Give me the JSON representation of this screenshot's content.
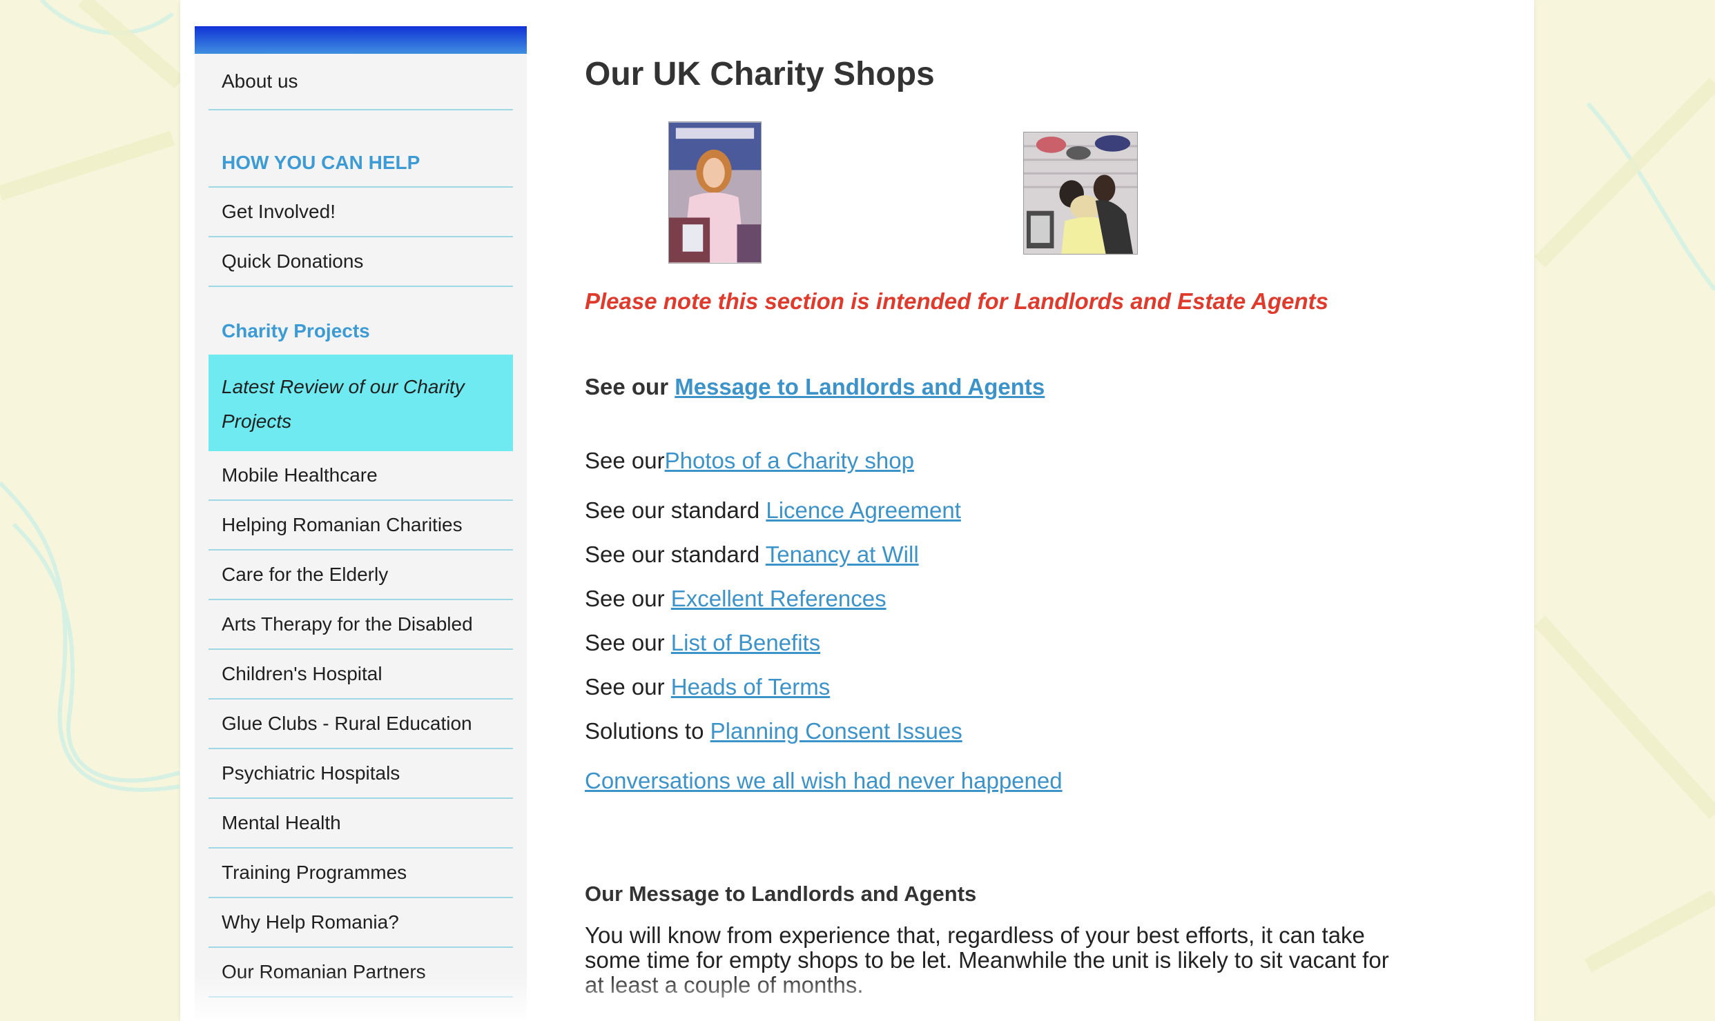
{
  "sidebar": {
    "about": "About us",
    "help_heading": "HOW YOU CAN HELP",
    "help_items": [
      "Get Involved!",
      "Quick Donations"
    ],
    "projects_heading": "Charity Projects",
    "active_item": "Latest Review of our Charity Projects",
    "project_items": [
      "Mobile Healthcare",
      "Helping Romanian Charities",
      "Care for the Elderly",
      "Arts Therapy for the Disabled",
      "Children's Hospital",
      "Glue Clubs - Rural Education",
      "Psychiatric Hospitals",
      "Mental Health",
      "Training Programmes",
      "Why Help Romania?",
      "Our Romanian Partners"
    ]
  },
  "main": {
    "title": "Our UK Charity Shops",
    "note": "Please note this section is intended for Landlords and Estate Agents",
    "message_line": {
      "prefix": "See our",
      "link": "Message to Landlords and Agents"
    },
    "links": [
      {
        "prefix": "See our",
        "link": "Photos of a Charity shop"
      },
      {
        "prefix": "See our standard",
        "link": "Licence Agreement"
      },
      {
        "prefix": "See our standard",
        "link": "Tenancy at Will"
      },
      {
        "prefix": "See our",
        "link": "Excellent References"
      },
      {
        "prefix": "See our",
        "link": "List of Benefits"
      },
      {
        "prefix": "See our",
        "link": "Heads of Terms"
      },
      {
        "prefix": "Solutions to",
        "link": "Planning Consent Issues"
      }
    ],
    "conversations_link": "Conversations we all wish had never happened",
    "section_heading": "Our Message to Landlords and Agents",
    "section_text": "You will know from experience that, regardless of your best efforts, it can take some time for empty shops to be let. Meanwhile the unit is likely to sit vacant for at least a couple of months."
  },
  "colors": {
    "accent_blue": "#3c93c9",
    "note_red": "#e03a2c",
    "active_bg": "#6eeaf0",
    "header_bar": "#1133d6"
  }
}
